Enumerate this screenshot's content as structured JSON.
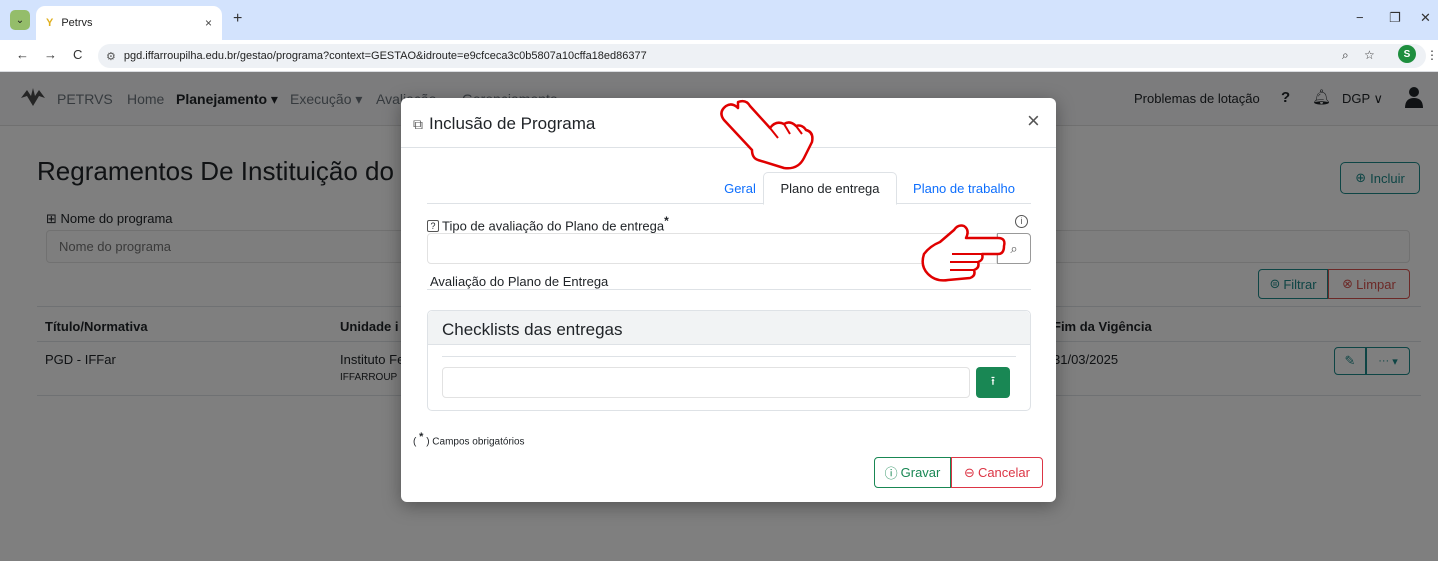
{
  "browser": {
    "tab_title": "Petrvs",
    "tab_close": "×",
    "new_tab": "+",
    "url": "pgd.iffarroupilha.edu.br/gestao/programa?context=GESTAO&idroute=e9cfceca3c0b5807a10cffa18ed86377",
    "profile_initial": "S",
    "icons": [
      "chevron-down-icon",
      "petrvs-favicon-icon",
      "back-icon",
      "forward-icon",
      "reload-icon",
      "site-settings-icon",
      "zoom-icon",
      "star-icon",
      "menu-icon"
    ]
  },
  "navbar": {
    "brand": "PETRVS",
    "items": [
      "Home",
      "Planejamento",
      "Execução",
      "Avaliação",
      "Gerenciamento"
    ],
    "problems": "Problemas de lotação",
    "help": "?",
    "unit": "DGP"
  },
  "page": {
    "title": "Regramentos De Instituição do Pg",
    "incluir": "Incluir",
    "name_label": "Nome do programa",
    "name_placeholder": "Nome do programa",
    "filtrar": "Filtrar",
    "limpar": "Limpar",
    "columns": [
      "Título/Normativa",
      "Unidade i",
      "Fim da Vigência"
    ],
    "row": {
      "titulo": "PGD - IFFar",
      "unidade": "Instituto Fe",
      "unidade_sub": "IFFARROUP",
      "fim": "31/03/2025",
      "more": "···"
    }
  },
  "modal": {
    "title": "Inclusão de Programa",
    "close": "×",
    "tabs": [
      "Geral",
      "Plano de entrega",
      "Plano de trabalho"
    ],
    "active_tab": "Plano de entrega",
    "tipo_label": "Tipo de avaliação do Plano de entrega",
    "required_mark": "*",
    "aval_label": "Avaliação do Plano de Entrega",
    "checklist_title": "Checklists das entregas",
    "required_note_prefix": "(",
    "required_note_star": "*",
    "required_note_text": ") Campos obrigatórios",
    "gravar": "Gravar",
    "cancelar": "Cancelar"
  },
  "colors": {
    "teal": "#1d8a8a",
    "danger": "#dc3545",
    "success": "#198754",
    "link": "#0d6efd",
    "annotation": "#e00000"
  }
}
